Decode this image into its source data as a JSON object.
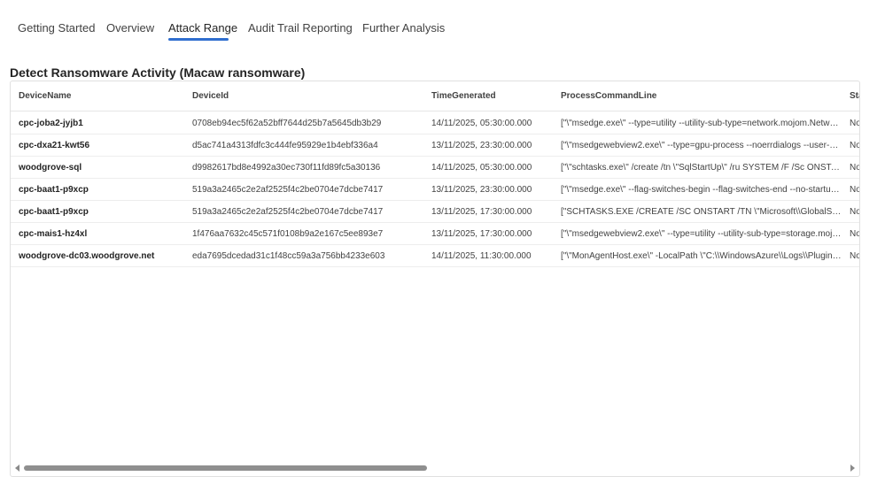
{
  "tabs": [
    {
      "label": "Getting Started",
      "active": false
    },
    {
      "label": "Overview",
      "active": false
    },
    {
      "label": "Attack Range",
      "active": true
    },
    {
      "label": "Audit Trail Reporting",
      "active": false
    },
    {
      "label": "Further Analysis",
      "active": false
    }
  ],
  "section": {
    "title": "Detect Ransomware Activity (Macaw ransomware)"
  },
  "table": {
    "columns": [
      "DeviceName",
      "DeviceId",
      "TimeGenerated",
      "ProcessCommandLine",
      "Sta"
    ],
    "rows": [
      {
        "device": "cpc-joba2-jyjb1",
        "id": "0708eb94ec5f62a52bff7644d25b7a5645db3b29",
        "time": "14/11/2025, 05:30:00.000",
        "cmd": "[\"\\\"msedge.exe\\\" --type=utility --utility-sub-type=network.mojom.NetworkService",
        "status": "No"
      },
      {
        "device": "cpc-dxa21-kwt56",
        "id": "d5ac741a4313fdfc3c444fe95929e1b4ebf336a4",
        "time": "13/11/2025, 23:30:00.000",
        "cmd": "[\"\\\"msedgewebview2.exe\\\" --type=gpu-process --noerrdialogs --user-data-dir",
        "status": "No"
      },
      {
        "device": "woodgrove-sql",
        "id": "d9982617bd8e4992a30ec730f11fd89fc5a30136",
        "time": "14/11/2025, 05:30:00.000",
        "cmd": "[\"\\\"schtasks.exe\\\" /create /tn \\\"SqlStartUp\\\" /ru SYSTEM /F /Sc ONSTART /tr",
        "status": "No"
      },
      {
        "device": "cpc-baat1-p9xcp",
        "id": "519a3a2465c2e2af2525f4c2be0704e7dcbe7417",
        "time": "13/11/2025, 23:30:00.000",
        "cmd": "[\"\\\"msedge.exe\\\" --flag-switches-begin --flag-switches-end --no-startup-window",
        "status": "No"
      },
      {
        "device": "cpc-baat1-p9xcp",
        "id": "519a3a2465c2e2af2525f4c2be0704e7dcbe7417",
        "time": "13/11/2025, 17:30:00.000",
        "cmd": "[\"SCHTASKS.EXE /CREATE /SC ONSTART /TN \\\"Microsoft\\\\GlobalSecureAccess",
        "status": "No"
      },
      {
        "device": "cpc-mais1-hz4xl",
        "id": "1f476aa7632c45c571f0108b9a2e167c5ee893e7",
        "time": "13/11/2025, 17:30:00.000",
        "cmd": "[\"\\\"msedgewebview2.exe\\\" --type=utility --utility-sub-type=storage.mojom.StorageService",
        "status": "No"
      },
      {
        "device": "woodgrove-dc03.woodgrove.net",
        "id": "eda7695dcedad31c1f48cc59a3a756bb4233e603",
        "time": "14/11/2025, 11:30:00.000",
        "cmd": "[\"\\\"MonAgentHost.exe\\\" -LocalPath \\\"C:\\\\WindowsAzure\\\\Logs\\\\Plugins\\\\",
        "status": "No"
      }
    ]
  },
  "scrollbar": {
    "visible_fraction": 0.49
  },
  "colors": {
    "accent": "#2f6ecf",
    "border": "#e0e0e0",
    "scroll_thumb": "#8f8f8f"
  },
  "icons": {
    "scroll_left": "triangle-left-icon",
    "scroll_right": "triangle-right-icon"
  }
}
